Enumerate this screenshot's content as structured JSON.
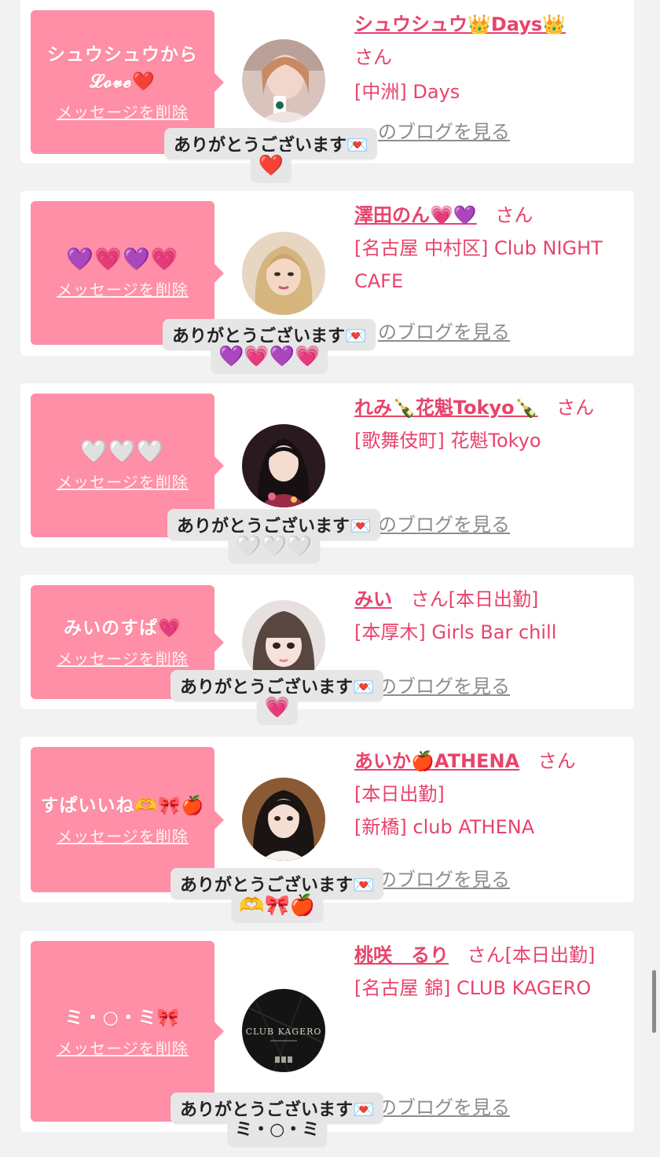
{
  "common": {
    "delete_label": "メッセージを削除",
    "blog_label": "のブログを見る",
    "reply_label": "ありがとうございます💌",
    "honorific": "さん"
  },
  "colors": {
    "page_bg": "#f2f2f2",
    "card_bg": "#ffffff",
    "bubble_pink": "#ff8fa6",
    "accent_pink": "#e8436b",
    "link_gray": "#8d8d8d"
  },
  "entries": [
    {
      "bubble_text": "シュウシュウから𝓛𝓸𝓿𝓮❤️",
      "name": "シュウシュウ👑Days👑",
      "status": "",
      "area": "[中洲]",
      "shop": "Days",
      "reply_emoji": "❤️",
      "avatar_icon": "woman-with-coffee-photo"
    },
    {
      "bubble_text": "💜💗💜💗",
      "name": "澤田のん💗💜",
      "status": "",
      "area": "[名古屋 中村区]",
      "shop": "Club NIGHT CAFE",
      "reply_emoji": "💜💗💜💗",
      "avatar_icon": "blonde-woman-photo"
    },
    {
      "bubble_text": "🤍🤍🤍",
      "name": "れみ🍾花魁Tokyo🍾",
      "status": "",
      "area": "[歌舞伎町]",
      "shop": "花魁Tokyo",
      "reply_emoji": "🤍🤍🤍",
      "avatar_icon": "woman-in-kimono-photo"
    },
    {
      "bubble_text": "みいのすぱ💗",
      "name": "みい",
      "status": "[本日出勤]",
      "area": "[本厚木]",
      "shop": "Girls Bar chill",
      "reply_emoji": "💗",
      "avatar_icon": "woman-with-bangs-photo"
    },
    {
      "bubble_text": "すぱいいね🫶🎀🍎",
      "name": "あいか🍎ATHENA",
      "status": "[本日出勤]",
      "area": "[新橋]",
      "shop": "club ATHENA",
      "reply_emoji": "🫶🎀🍎",
      "avatar_icon": "dark-haired-woman-photo"
    },
    {
      "bubble_text": "ミ・○・ミ🎀",
      "name": "桃咲　るり",
      "status": "[本日出勤]",
      "area": "[名古屋 錦]",
      "shop": "CLUB KAGERO",
      "reply_emoji": "ミ・○・ミ",
      "avatar_icon": "club-kagero-logo",
      "avatar_logo_text": "CLUB KAGERO"
    }
  ]
}
